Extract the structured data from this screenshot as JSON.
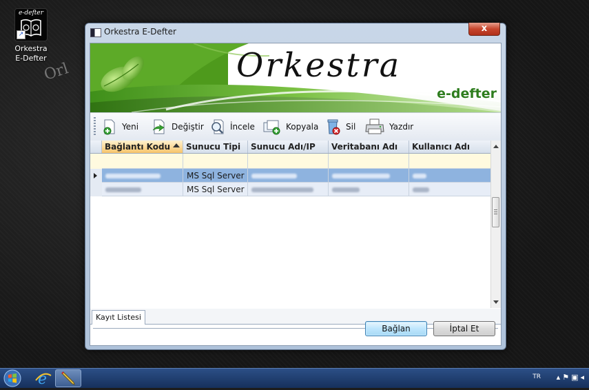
{
  "desktop": {
    "icon_badge": "e-defter",
    "icon_label_line1": "Orkestra",
    "icon_label_line2": "E-Defter",
    "watermark": "Orl"
  },
  "window": {
    "title": "Orkestra E-Defter",
    "close_label": "x"
  },
  "banner": {
    "title": "Orkestra",
    "subtitle": "e-defter"
  },
  "toolbar": {
    "new": "Yeni",
    "edit": "Değiştir",
    "inspect": "İncele",
    "copy": "Kopyala",
    "delete": "Sil",
    "print": "Yazdır"
  },
  "grid": {
    "columns": [
      "Bağlantı Kodu",
      "Sunucu Tipi",
      "Sunucu Adı/IP",
      "Veritabanı Adı",
      "Kullanıcı Adı"
    ],
    "rows": [
      {
        "server_type": "MS Sql Server"
      },
      {
        "server_type": "MS Sql Server"
      }
    ]
  },
  "tabs": {
    "record_list": "Kayıt Listesi"
  },
  "buttons": {
    "connect": "Bağlan",
    "cancel": "İptal Et"
  },
  "taskbar": {
    "language": "TR"
  },
  "colors": {
    "accent_green": "#2e7d1e",
    "selection": "#8eb3df",
    "filter_row": "#fffadf",
    "sorted_header": "#f8c46a"
  }
}
